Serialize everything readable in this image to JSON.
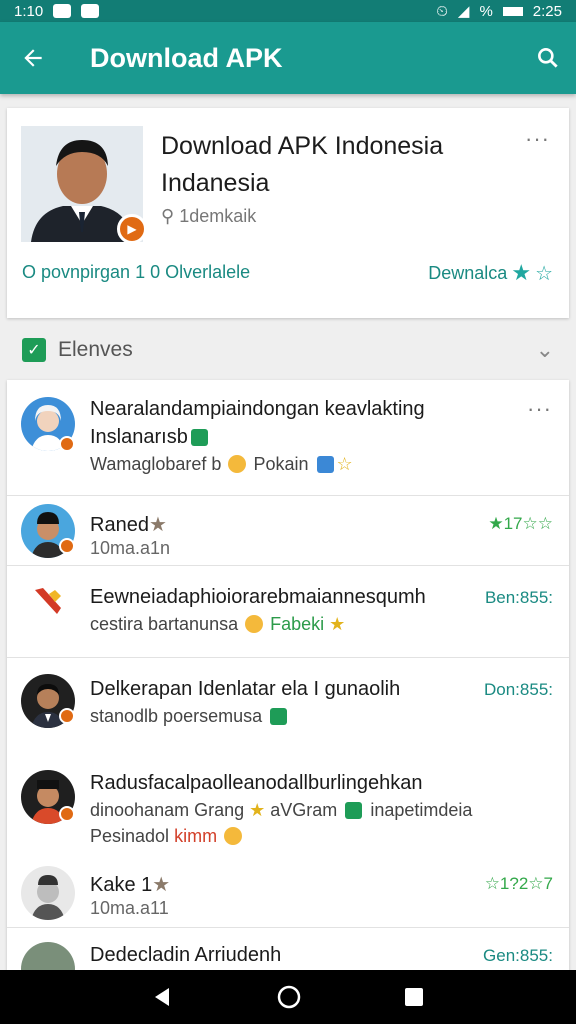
{
  "status_bar": {
    "time_left": "1:10",
    "battery_text": "%",
    "time_right": "2:25"
  },
  "app_bar": {
    "title": "Download APK"
  },
  "app_card": {
    "title": "Download APK Indonesia Indanesia",
    "developer": "1demkaik",
    "info_text": "O povnpirgan 1 0 Olverlalele",
    "download_label": "Dewnalca",
    "more": "···"
  },
  "section": {
    "label": "Elenves"
  },
  "rows": [
    {
      "title": "Nearalandampiaindongan keavlakting",
      "title2": "Inslanarısb",
      "sub_a": "Wamaglobaref b",
      "sub_b": "Pokain",
      "more": "···"
    },
    {
      "title": "Raned",
      "sub": "10ma.a1n",
      "rating": "★17☆☆"
    },
    {
      "title": "Eewneiadaphioiorarebmaiannesqumh",
      "sub_a": "cestira bartanunsa",
      "sub_b": "Fabeki",
      "meta": "Ben:855:"
    },
    {
      "title": "Delkerapan Idenlatar ela I gunaolih",
      "sub": "stanodlb poersemusa",
      "meta": "Don:855:"
    },
    {
      "title": "Radusfacalpaolleanodallburlingehkan",
      "sub_a": "dinoohanam Grang",
      "sub_b": "aVGram",
      "sub_c": "inapetimdeia",
      "sub2_a": "Pesinadol",
      "sub2_b": "kimm"
    },
    {
      "title": "Kake 1",
      "sub": "10ma.a11",
      "rating": "☆1?2☆7"
    },
    {
      "title": "Dedecladin Arriudenh",
      "meta": "Gen:855:"
    }
  ],
  "colors": {
    "app_bar": "#1a9a90",
    "status_bar": "#127d75",
    "accent": "#1a8a82",
    "green": "#1e9c57",
    "badge": "#e06a13"
  }
}
